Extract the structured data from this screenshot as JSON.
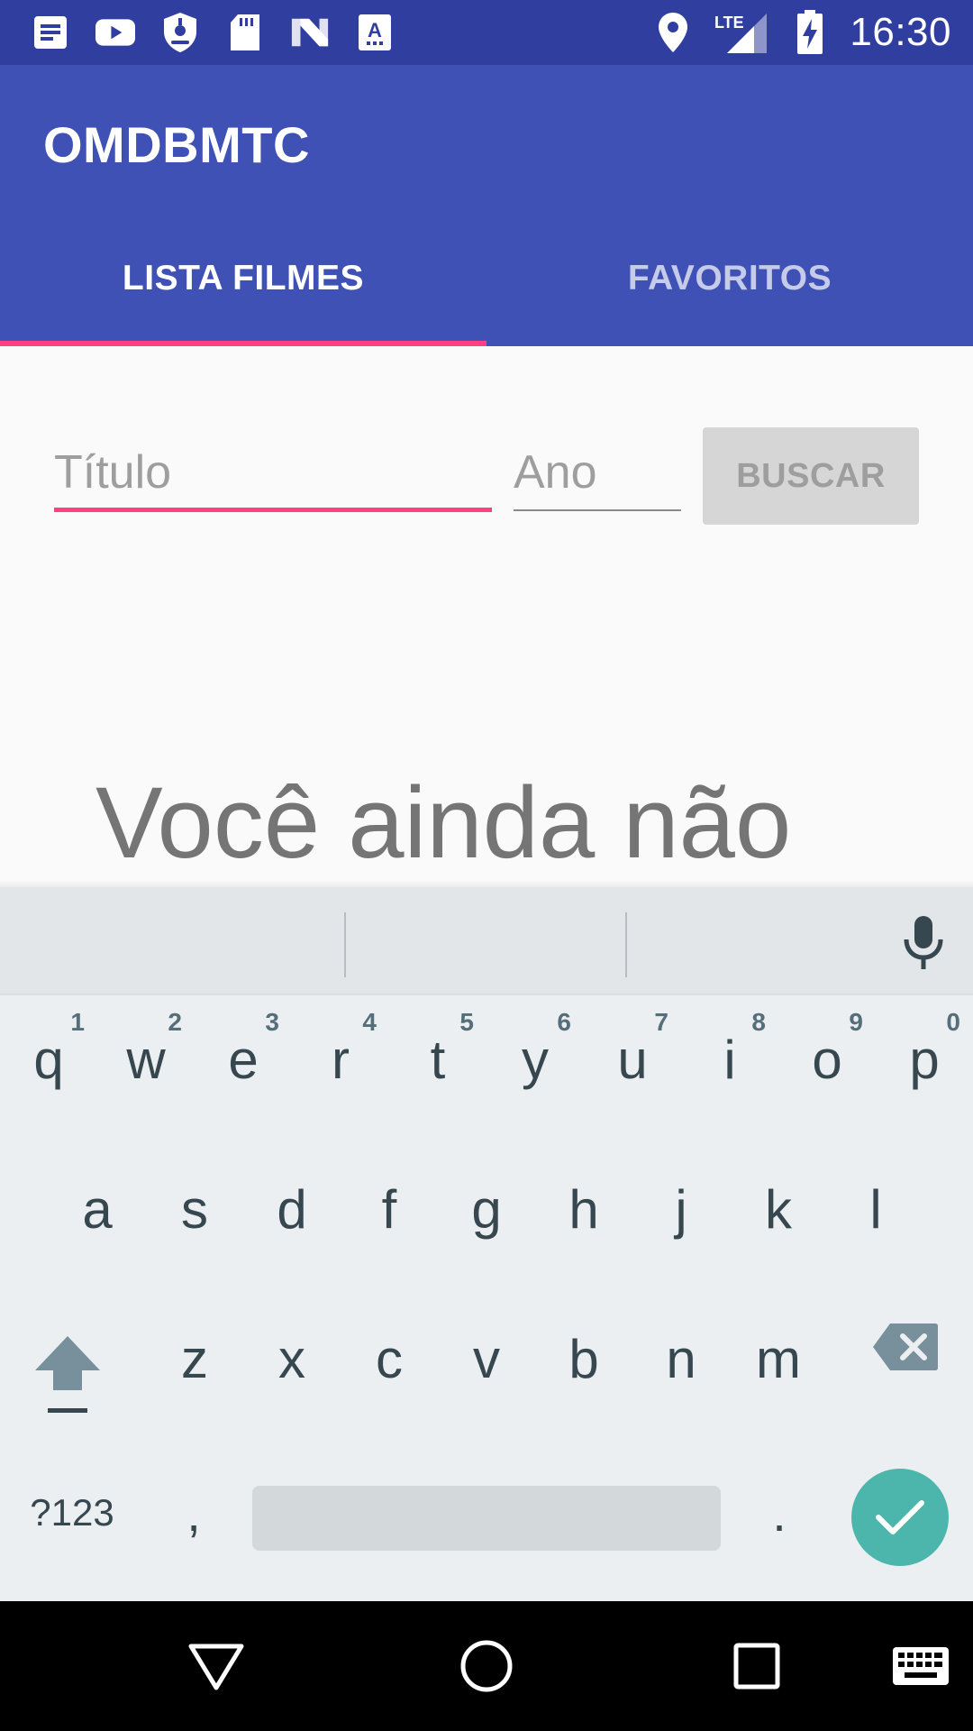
{
  "status_bar": {
    "time": "16:30",
    "network": "LTE",
    "left_icons": [
      "notes-icon",
      "youtube-icon",
      "shield-icon",
      "sd-card-icon",
      "n-icon",
      "font-icon"
    ],
    "right_icons": [
      "location-icon",
      "lte-signal-icon",
      "battery-charging-icon"
    ]
  },
  "app_bar": {
    "title": "OMDBMTC",
    "tabs": [
      {
        "label": "LISTA FILMES",
        "active": true
      },
      {
        "label": "FAVORITOS",
        "active": false
      }
    ]
  },
  "search": {
    "title_placeholder": "Título",
    "title_value": "",
    "year_placeholder": "Ano",
    "year_value": "",
    "button_label": "BUSCAR"
  },
  "empty_message": "Você ainda não",
  "keyboard": {
    "row1": [
      {
        "char": "q",
        "hint": "1"
      },
      {
        "char": "w",
        "hint": "2"
      },
      {
        "char": "e",
        "hint": "3"
      },
      {
        "char": "r",
        "hint": "4"
      },
      {
        "char": "t",
        "hint": "5"
      },
      {
        "char": "y",
        "hint": "6"
      },
      {
        "char": "u",
        "hint": "7"
      },
      {
        "char": "i",
        "hint": "8"
      },
      {
        "char": "o",
        "hint": "9"
      },
      {
        "char": "p",
        "hint": "0"
      }
    ],
    "row2": [
      "a",
      "s",
      "d",
      "f",
      "g",
      "h",
      "j",
      "k",
      "l"
    ],
    "row3": [
      "z",
      "x",
      "c",
      "v",
      "b",
      "n",
      "m"
    ],
    "symbols_label": "?123",
    "comma": ",",
    "period": "."
  },
  "colors": {
    "status_bar": "#303F9F",
    "app_bar": "#3F51B5",
    "accent": "#FF4081",
    "enter_key": "#4DB6AC"
  }
}
